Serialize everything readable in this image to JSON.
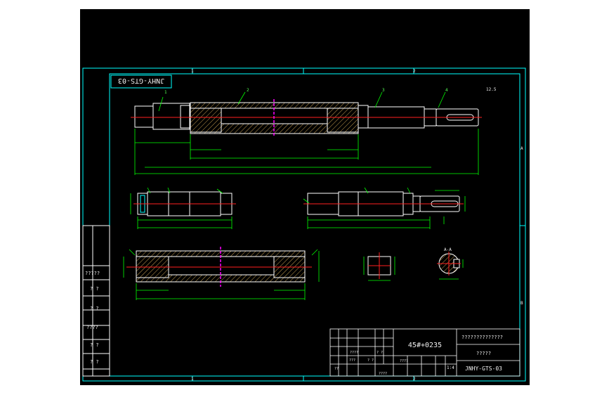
{
  "drawing": {
    "title_flipped": "JNHY-GTS-03",
    "material": "45#+0235",
    "company": "??????????????",
    "part_name": "?????",
    "drawing_no": "JNHY-GTS-03",
    "scale_cell": "1:4",
    "row_labels": [
      "?????",
      "? ?",
      "? ?",
      "????",
      "? ?",
      "? ?"
    ],
    "zone_letters_top": [
      "1",
      "2",
      "3"
    ],
    "zone_letters_side": [
      "A",
      "B"
    ],
    "callouts": [
      "1",
      "2",
      "3",
      "4"
    ],
    "table_cells": {
      "a": "????",
      "b": "? ?",
      "c": "???",
      "d": "? ?",
      "e": "??",
      "f": "????",
      "g": "????"
    },
    "section_label": "A-A",
    "roughness": "12.5"
  },
  "colors": {
    "frame": "#00ffff",
    "part": "#ffffff",
    "dim": "#00ff00",
    "center": "#ff2020",
    "cut": "#ff00ff",
    "hatch": "#c8a050"
  }
}
